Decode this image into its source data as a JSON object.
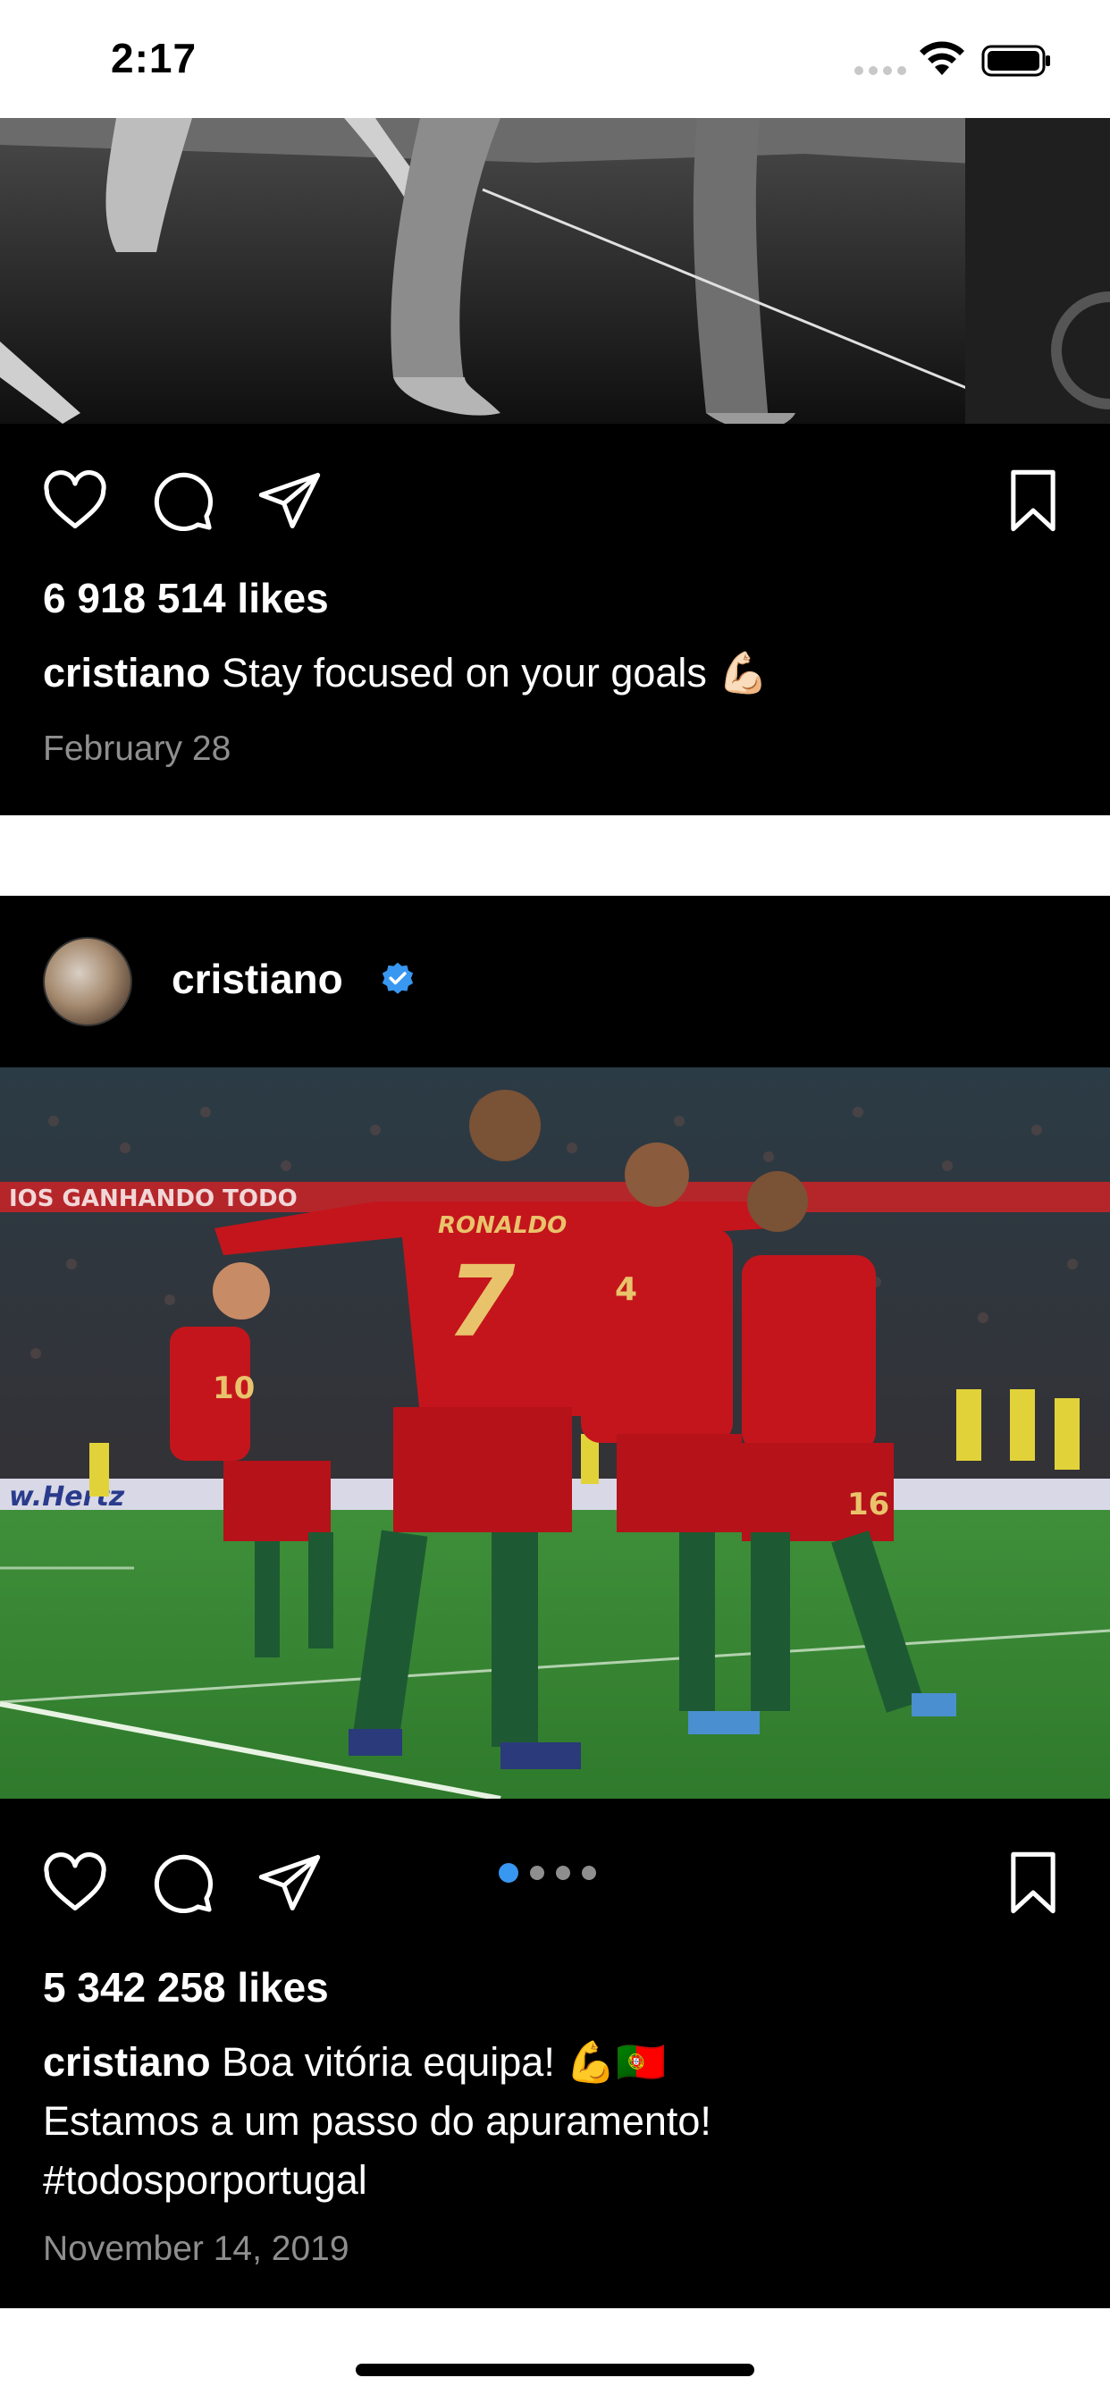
{
  "status_bar": {
    "time": "2:17"
  },
  "posts": [
    {
      "likes": "6 918 514 likes",
      "username": "cristiano",
      "caption": "Stay focused on your goals",
      "caption_emoji": "💪🏻",
      "date": "February 28"
    },
    {
      "username": "cristiano",
      "verified": true,
      "likes": "5 342 258 likes",
      "caption_user": "cristiano",
      "caption_line1": "Boa vitória equipa!",
      "caption_line1_emoji": "💪🇵🇹",
      "caption_line2": "Estamos a um passo do apuramento!",
      "caption_line3": "#todosporportugal",
      "date": "November 14, 2019",
      "carousel": {
        "count": 4,
        "active": 0
      }
    }
  ],
  "colors": {
    "accent": "#3897f0",
    "background": "#000000",
    "muted": "#8e8e8e"
  }
}
